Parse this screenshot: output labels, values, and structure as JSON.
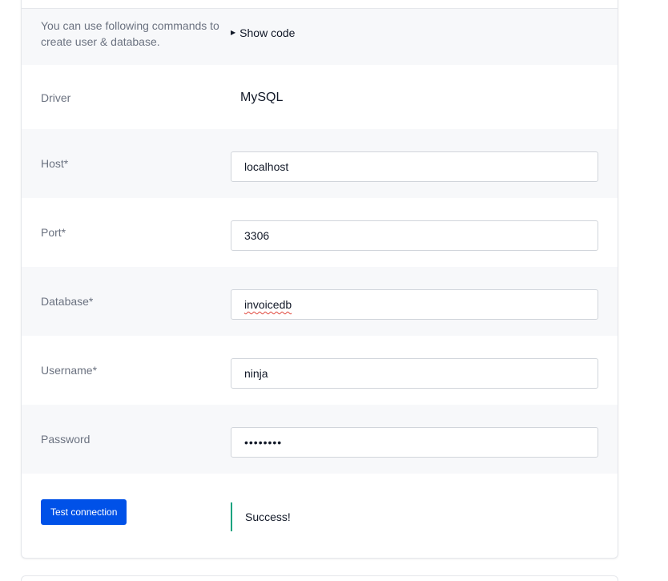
{
  "commands": {
    "label": "You can use following commands to create user & database.",
    "toggle_label": "Show code"
  },
  "driver": {
    "label": "Driver",
    "value": "MySQL"
  },
  "host": {
    "label": "Host*",
    "value": "localhost"
  },
  "port": {
    "label": "Port*",
    "value": "3306"
  },
  "database": {
    "label": "Database*",
    "value": "invoicedb"
  },
  "username": {
    "label": "Username*",
    "value": "ninja"
  },
  "password": {
    "label": "Password",
    "masked_value": "••••••••"
  },
  "test": {
    "button_label": "Test connection",
    "status_text": "Success!"
  },
  "colors": {
    "primary_button": "#0051e8",
    "success_border": "#10a37f",
    "row_alt_background": "#f7f8fa"
  }
}
